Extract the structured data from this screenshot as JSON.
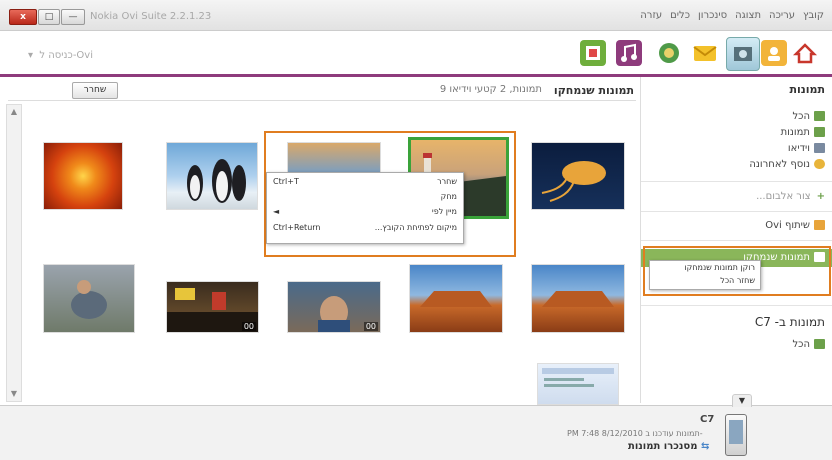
{
  "window": {
    "title": "Nokia Ovi Suite 2.2.1.23",
    "controls": {
      "close": "x",
      "maximize": "□",
      "minimize": "—"
    }
  },
  "menu": [
    "קובץ",
    "עריכה",
    "תצוגה",
    "סינכרון",
    "כלים",
    "עזרה"
  ],
  "toolbar": {
    "ovi_dropdown": "כניסה ל-Ovi",
    "icons": [
      "home-icon",
      "contacts-icon",
      "photos-icon",
      "messages-icon",
      "maps-icon",
      "music-icon",
      "applications-icon"
    ]
  },
  "content": {
    "release_button": "שחרר",
    "title": "תמונות שנמחקו",
    "count": "9 תמונות, 2 קטעי וידיאו",
    "video_badge": "00",
    "context_menu": [
      {
        "label": "שחרר",
        "shortcut": "Ctrl+T"
      },
      {
        "label": "מחק",
        "shortcut": ""
      },
      {
        "label": "מיין לפי",
        "shortcut": "◄"
      },
      {
        "label": "מיקום לפתיחת הקובץ...",
        "shortcut": "Ctrl+Return"
      }
    ]
  },
  "sidebar": {
    "photos_header": "תמונות",
    "items": [
      {
        "label": "הכל",
        "icon": "image-icon"
      },
      {
        "label": "תמונות",
        "icon": "image-icon"
      },
      {
        "label": "וידיאו",
        "icon": "video-icon"
      },
      {
        "label": "נוסף לאחרונה",
        "icon": "clock-icon"
      }
    ],
    "create_album": "צור אלבום...",
    "ovi_share": "שיתוף Ovi",
    "deleted_item": "תמונות שנמחקו",
    "context_menu": [
      "רוקן תמונות שנמחקו",
      "שחזר הכל"
    ],
    "device_header": "תמונות ב- C7",
    "device_all": "הכל"
  },
  "bottom": {
    "device_name": "C7",
    "updated_label": "תמונות עודכנו ב-",
    "updated_time": "PM 7:48 8/12/2010",
    "sync_label": "מסנכרו תמונות"
  },
  "colors": {
    "accent_purple": "#8e3b7c",
    "highlight_orange": "#e07d20",
    "selected_green": "#3aa33a",
    "sidebar_active": "#8ab65a"
  }
}
